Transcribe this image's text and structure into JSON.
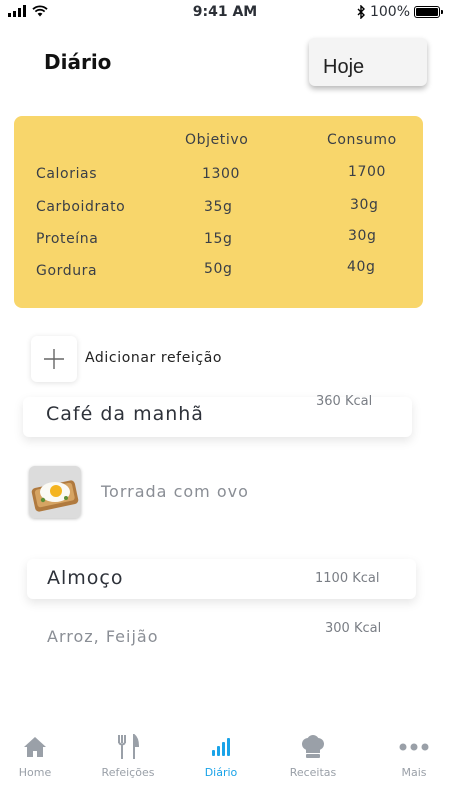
{
  "status_bar": {
    "time": "9:41 AM",
    "battery": "100%"
  },
  "header": {
    "title": "Diário",
    "date_button": "Hoje"
  },
  "summary": {
    "headers": [
      "Objetivo",
      "Consumo"
    ],
    "rows": [
      {
        "label": "Calorias",
        "goal": "1300",
        "consumed": "1700"
      },
      {
        "label": "Carboidrato",
        "goal": "35g",
        "consumed": "30g"
      },
      {
        "label": "Proteína",
        "goal": "15g",
        "consumed": "30g"
      },
      {
        "label": "Gordura",
        "goal": "50g",
        "consumed": "40g"
      }
    ]
  },
  "add_meal": {
    "label": "Adicionar refeição"
  },
  "meals": [
    {
      "name": "Café da manhã",
      "kcal": "360 Kcal",
      "foods": [
        {
          "name": "Torrada com ovo"
        }
      ]
    },
    {
      "name": "Almoço",
      "kcal": "1100 Kcal",
      "foods": [
        {
          "name": "Arroz, Feijão",
          "kcal": "300 Kcal"
        }
      ]
    }
  ],
  "tabs": [
    {
      "label": "Home",
      "icon": "home-icon",
      "active": false
    },
    {
      "label": "Refeições",
      "icon": "utensils-icon",
      "active": false
    },
    {
      "label": "Diário",
      "icon": "bar-chart-icon",
      "active": true
    },
    {
      "label": "Receitas",
      "icon": "chef-hat-icon",
      "active": false
    },
    {
      "label": "Mais",
      "icon": "more-icon",
      "active": false
    }
  ],
  "colors": {
    "accent": "#1aa3e8",
    "summary_bg": "#f8d66b",
    "tab_inactive": "#9aa0a8"
  }
}
